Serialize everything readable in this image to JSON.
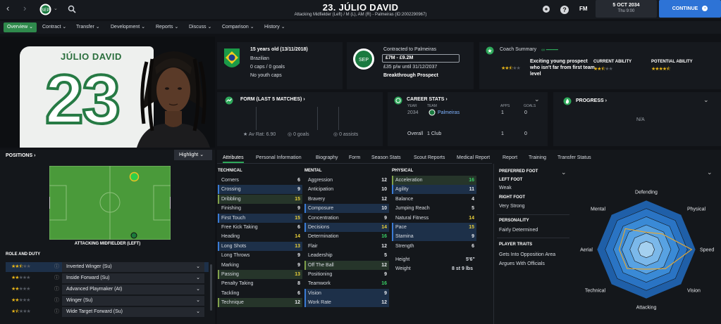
{
  "colors": {
    "accent": "#2d73d6",
    "green": "#2ea85a",
    "highlight_blue": "#1d3049",
    "highlight_green": "#26352a",
    "star": "#e7b418"
  },
  "header": {
    "title": "23. JÚLIO DAVID",
    "subtitle": "Attacking Midfielder (Left) / M (L), AM (R) - Palmeiras (ID:2002290967)",
    "date": "5 OCT 2034",
    "time": "Thu 9:00",
    "continue_label": "CONTINUE",
    "fm_label": "FM",
    "help_label": "?"
  },
  "nav": {
    "items": [
      "Overview",
      "Contract",
      "Transfer",
      "Development",
      "Reports",
      "Discuss",
      "Comparison",
      "History"
    ],
    "active": "Overview"
  },
  "hero": {
    "shirt_name": "JÚLIO DAVID",
    "shirt_number": "23"
  },
  "bio": {
    "age": "15 years old (13/11/2018)",
    "nationality": "Brazilian",
    "caps": "0 caps / 0 goals",
    "youth_caps": "No youth caps"
  },
  "contract": {
    "heading": "Contracted to Palmeiras",
    "value": "£7M - £9.2M",
    "wage": "£35 p/w until 31/12/2037",
    "status": "Breakthrough Prospect"
  },
  "coach": {
    "heading": "Coach Summary",
    "text": "Exciting young prospect who isn't far from first team level",
    "current_ability_label": "CURRENT ABILITY",
    "potential_ability_label": "POTENTIAL ABILITY",
    "stars": 2.5,
    "current_ability_stars": 2.5,
    "potential_ability_stars": 4.5
  },
  "form": {
    "heading": "FORM (LAST 5 MATCHES)",
    "av_rat": "Av Rat: 6.90",
    "goals": "0 goals",
    "assists": "0 assists"
  },
  "career": {
    "heading": "CAREER STATS",
    "columns": [
      "YEAR",
      "TEAM",
      "APPS",
      "GOALS"
    ],
    "row": {
      "year": "2034",
      "team": "Palmeiras",
      "apps": "1",
      "goals": "0"
    },
    "total": {
      "label": "Overall",
      "clubs": "1 Club",
      "apps": "1",
      "goals": "0"
    }
  },
  "progress": {
    "heading": "PROGRESS",
    "value": "N/A"
  },
  "positions": {
    "heading": "POSITIONS",
    "highlight_label": "Highlight",
    "role_caption": "ATTACKING MIDFIELDER (LEFT)"
  },
  "role_duty": {
    "heading": "ROLE AND DUTY",
    "items": [
      {
        "label": "Inverted Winger (Su)",
        "stars": 2.5
      },
      {
        "label": "Inside Forward (Su)",
        "stars": 2
      },
      {
        "label": "Advanced Playmaker (At)",
        "stars": 2
      },
      {
        "label": "Winger (Su)",
        "stars": 2
      },
      {
        "label": "Wide Target Forward (Su)",
        "stars": 1.5
      }
    ]
  },
  "subtabs": [
    "Attributes",
    "Personal Information",
    "Biography",
    "Form",
    "Season Stats",
    "Scout Reports",
    "Medical Report",
    "Report",
    "Training",
    "Transfer Status"
  ],
  "technical": {
    "heading": "TECHNICAL",
    "rows": [
      {
        "name": "Corners",
        "value": "6",
        "hl": ""
      },
      {
        "name": "Crossing",
        "value": "9",
        "hl": "b"
      },
      {
        "name": "Dribbling",
        "value": "15",
        "hl": "g"
      },
      {
        "name": "Finishing",
        "value": "9",
        "hl": ""
      },
      {
        "name": "First Touch",
        "value": "15",
        "hl": "b"
      },
      {
        "name": "Free Kick Taking",
        "value": "6",
        "hl": ""
      },
      {
        "name": "Heading",
        "value": "14",
        "hl": ""
      },
      {
        "name": "Long Shots",
        "value": "13",
        "hl": "b"
      },
      {
        "name": "Long Throws",
        "value": "9",
        "hl": ""
      },
      {
        "name": "Marking",
        "value": "9",
        "hl": ""
      },
      {
        "name": "Passing",
        "value": "13",
        "hl": "g"
      },
      {
        "name": "Penalty Taking",
        "value": "8",
        "hl": ""
      },
      {
        "name": "Tackling",
        "value": "6",
        "hl": ""
      },
      {
        "name": "Technique",
        "value": "12",
        "hl": "g"
      }
    ]
  },
  "mental": {
    "heading": "MENTAL",
    "rows": [
      {
        "name": "Aggression",
        "value": "12",
        "hl": ""
      },
      {
        "name": "Anticipation",
        "value": "10",
        "hl": ""
      },
      {
        "name": "Bravery",
        "value": "12",
        "hl": ""
      },
      {
        "name": "Composure",
        "value": "10",
        "hl": "b"
      },
      {
        "name": "Concentration",
        "value": "9",
        "hl": ""
      },
      {
        "name": "Decisions",
        "value": "14",
        "hl": "b"
      },
      {
        "name": "Determination",
        "value": "16",
        "hl": ""
      },
      {
        "name": "Flair",
        "value": "12",
        "hl": ""
      },
      {
        "name": "Leadership",
        "value": "5",
        "hl": ""
      },
      {
        "name": "Off The Ball",
        "value": "12",
        "hl": "g"
      },
      {
        "name": "Positioning",
        "value": "9",
        "hl": ""
      },
      {
        "name": "Teamwork",
        "value": "16",
        "hl": ""
      },
      {
        "name": "Vision",
        "value": "9",
        "hl": "b"
      },
      {
        "name": "Work Rate",
        "value": "12",
        "hl": "b"
      }
    ]
  },
  "physical": {
    "heading": "PHYSICAL",
    "rows": [
      {
        "name": "Acceleration",
        "value": "16",
        "hl": "g"
      },
      {
        "name": "Agility",
        "value": "11",
        "hl": "b"
      },
      {
        "name": "Balance",
        "value": "4",
        "hl": ""
      },
      {
        "name": "Jumping Reach",
        "value": "5",
        "hl": ""
      },
      {
        "name": "Natural Fitness",
        "value": "14",
        "hl": ""
      },
      {
        "name": "Pace",
        "value": "15",
        "hl": "b"
      },
      {
        "name": "Stamina",
        "value": "9",
        "hl": "b"
      },
      {
        "name": "Strength",
        "value": "6",
        "hl": ""
      }
    ],
    "height_label": "Height",
    "height": "5'6\"",
    "weight_label": "Weight",
    "weight": "8 st 9 lbs"
  },
  "foot": {
    "heading": "PREFERRED FOOT",
    "left_label": "LEFT FOOT",
    "left": "Weak",
    "right_label": "RIGHT FOOT",
    "right": "Very Strong"
  },
  "personality": {
    "heading": "PERSONALITY",
    "value": "Fairly Determined"
  },
  "traits": {
    "heading": "PLAYER TRAITS",
    "items": [
      "Gets Into Opposition Area",
      "Argues With Officials"
    ]
  },
  "radar": {
    "axes": [
      "Defending",
      "Physical",
      "Speed",
      "Vision",
      "Attacking",
      "Technical",
      "Aerial",
      "Mental"
    ],
    "values": [
      0.35,
      0.45,
      0.92,
      0.55,
      0.4,
      0.55,
      0.55,
      0.6
    ]
  }
}
